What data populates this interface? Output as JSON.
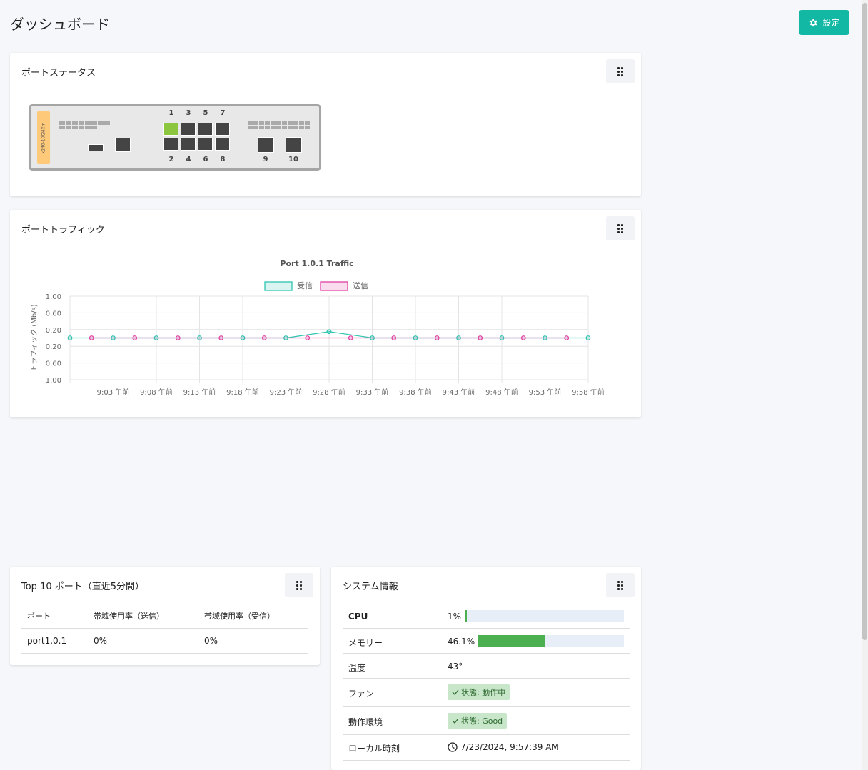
{
  "header": {
    "title": "ダッシュボード",
    "settings_label": "設定"
  },
  "port_status": {
    "title": "ポートステータス",
    "model": "x240-10GHXm",
    "ports_top": [
      "1",
      "3",
      "5",
      "7"
    ],
    "ports_bottom": [
      "2",
      "4",
      "6",
      "8"
    ],
    "sfp": [
      "9",
      "10"
    ],
    "port_states": {
      "1": "up",
      "2": "down",
      "3": "down",
      "4": "down",
      "5": "down",
      "6": "down",
      "7": "down",
      "8": "down",
      "9": "down",
      "10": "down"
    }
  },
  "traffic": {
    "title": "ポートトラフィック"
  },
  "chart_data": {
    "type": "line",
    "title": "Port 1.0.1 Traffic",
    "ylabel": "トラフィック (Mb/s)",
    "xlabel": "",
    "y_tick_labels": [
      "1.00",
      "0.60",
      "0.20",
      "0.20",
      "0.60",
      "1.00"
    ],
    "ylim": [
      -1,
      1
    ],
    "x_tick_labels": [
      "9:03 午前",
      "9:08 午前",
      "9:13 午前",
      "9:18 午前",
      "9:23 午前",
      "9:28 午前",
      "9:33 午前",
      "9:38 午前",
      "9:43 午前",
      "9:48 午前",
      "9:53 午前",
      "9:58 午前"
    ],
    "legend_position": "top",
    "series": [
      {
        "name": "受信",
        "color": "#2ec4b0",
        "points": [
          [
            0,
            0
          ],
          [
            1,
            0
          ],
          [
            2,
            0
          ],
          [
            3,
            0
          ],
          [
            4,
            0
          ],
          [
            5,
            0
          ],
          [
            6,
            0.15
          ],
          [
            7,
            0
          ],
          [
            8,
            0
          ],
          [
            9,
            0
          ],
          [
            10,
            0
          ],
          [
            11,
            0
          ],
          [
            12,
            0
          ]
        ]
      },
      {
        "name": "送信",
        "color": "#e040a0",
        "points": [
          [
            0.5,
            0
          ],
          [
            1.5,
            0
          ],
          [
            2.5,
            0
          ],
          [
            3.5,
            0
          ],
          [
            4.5,
            0
          ],
          [
            5.5,
            0
          ],
          [
            6.5,
            0
          ],
          [
            7.5,
            0
          ],
          [
            8.5,
            0
          ],
          [
            9.5,
            0
          ],
          [
            10.5,
            0
          ],
          [
            11.5,
            0
          ]
        ]
      }
    ]
  },
  "top10": {
    "title": "Top 10 ポート（直近5分間）",
    "columns": [
      "ポート",
      "帯域使用率（送信）",
      "帯域使用率（受信）"
    ],
    "rows": [
      [
        "port1.0.1",
        "0%",
        "0%"
      ]
    ]
  },
  "system": {
    "title": "システム情報",
    "cpu_label": "CPU",
    "cpu_value": "1%",
    "cpu_fraction": 0.01,
    "memory_label": "メモリー",
    "memory_value": "46.1%",
    "memory_fraction": 0.461,
    "temp_label": "温度",
    "temp_value": "43°",
    "fan_label": "ファン",
    "fan_status": "状態: 動作中",
    "env_label": "動作環境",
    "env_status": "状態: Good",
    "time_label": "ローカル時刻",
    "time_value": "7/23/2024, 9:57:39 AM"
  }
}
